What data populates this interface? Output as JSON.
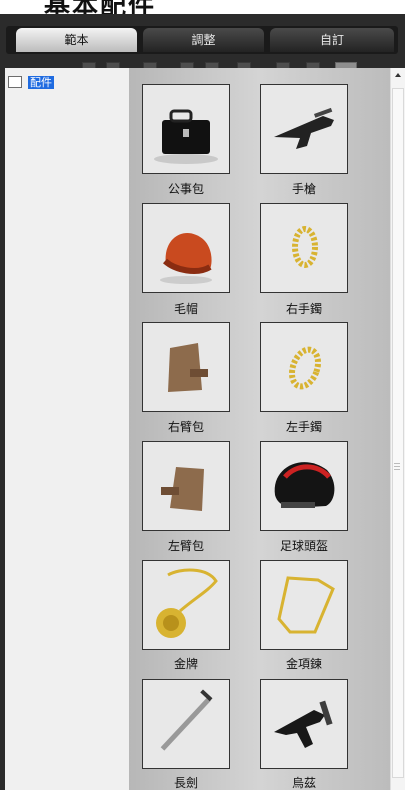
{
  "window": {
    "title": "基本配件"
  },
  "tabs": [
    {
      "label": "範本",
      "active": true
    },
    {
      "label": "調整",
      "active": false
    },
    {
      "label": "自訂",
      "active": false
    }
  ],
  "toolbar": {
    "buttons": [
      "new-folder-icon",
      "delete-icon",
      "window-icon",
      "cut-icon",
      "copy-icon",
      "paste-icon",
      "page-icon",
      "save-icon",
      "view-menu-icon"
    ]
  },
  "tree": {
    "items": [
      {
        "label": "配件",
        "selected": true
      }
    ]
  },
  "grid": {
    "items": [
      {
        "label": "公事包",
        "icon": "briefcase-icon"
      },
      {
        "label": "手槍",
        "icon": "pistol-icon"
      },
      {
        "label": "毛帽",
        "icon": "beanie-icon"
      },
      {
        "label": "右手鐲",
        "icon": "right-bracelet-icon"
      },
      {
        "label": "右臂包",
        "icon": "right-arm-bag-icon"
      },
      {
        "label": "左手鐲",
        "icon": "left-bracelet-icon"
      },
      {
        "label": "左臂包",
        "icon": "left-arm-bag-icon"
      },
      {
        "label": "足球頭盔",
        "icon": "football-helmet-icon"
      },
      {
        "label": "金牌",
        "icon": "gold-medal-icon"
      },
      {
        "label": "金項鍊",
        "icon": "gold-necklace-icon"
      },
      {
        "label": "長劍",
        "icon": "long-sword-icon"
      },
      {
        "label": "烏茲",
        "icon": "uzi-icon"
      }
    ]
  },
  "colors": {
    "frame": "#2b2b2b",
    "selection": "#1f6be0",
    "gold": "#d8b331",
    "hat": "#c94a1f"
  }
}
